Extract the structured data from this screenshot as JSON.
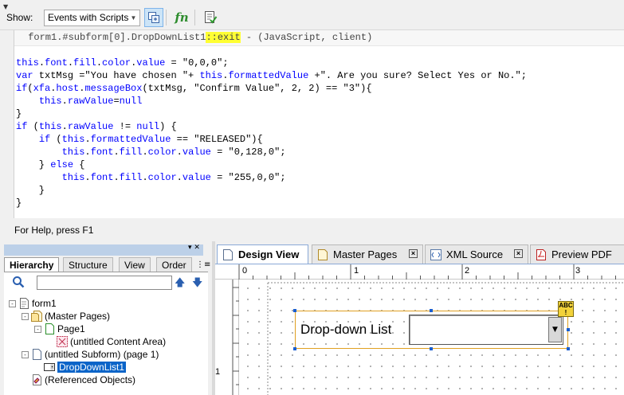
{
  "toolbar": {
    "show_label": "Show:",
    "show_value": "Events with Scripts"
  },
  "editor": {
    "header_prefix": " form1.#subform[0].DropDownList1",
    "header_event": "::exit",
    "header_suffix": " - (JavaScript, client)",
    "lines": [
      "this.font.fill.color.value = \"0,0,0\";",
      "var txtMsg =\"You have chosen \"+ this.formattedValue +\". Are you sure? Select Yes or No.\";",
      "if(xfa.host.messageBox(txtMsg, \"Confirm Value\", 2, 2) == \"3\"){",
      "    this.rawValue=null",
      "}",
      "if (this.rawValue != null) {",
      "    if (this.formattedValue == \"RELEASED\"){",
      "        this.font.fill.color.value = \"0,128,0\";",
      "    } else {",
      "        this.font.fill.color.value = \"255,0,0\";",
      "    }",
      "}"
    ]
  },
  "help_text": "For Help, press F1",
  "left_panel": {
    "tabs": [
      "Hierarchy",
      "Structure",
      "View",
      "Order"
    ],
    "tree": [
      {
        "label": "form1",
        "level": 0,
        "expander": "-",
        "icon": "form-icon"
      },
      {
        "label": "(Master Pages)",
        "level": 1,
        "expander": "-",
        "icon": "master-pages-icon"
      },
      {
        "label": "Page1",
        "level": 2,
        "expander": "-",
        "icon": "page-icon"
      },
      {
        "label": "(untitled Content Area)",
        "level": 3,
        "expander": "",
        "icon": "content-area-icon"
      },
      {
        "label": "(untitled Subform) (page 1)",
        "level": 1,
        "expander": "-",
        "icon": "subform-icon"
      },
      {
        "label": "DropDownList1",
        "level": 2,
        "expander": "",
        "icon": "dropdown-list-icon",
        "selected": true
      },
      {
        "label": "(Referenced Objects)",
        "level": 1,
        "expander": "",
        "icon": "referenced-objects-icon"
      }
    ]
  },
  "design": {
    "tabs": [
      "Design View",
      "Master Pages",
      "XML Source",
      "Preview PDF"
    ],
    "ruler_top": [
      "0",
      "1",
      "2",
      "3"
    ],
    "ruler_left": [
      "1"
    ],
    "field_caption": "Drop-down List",
    "field_badge": "ABC"
  }
}
